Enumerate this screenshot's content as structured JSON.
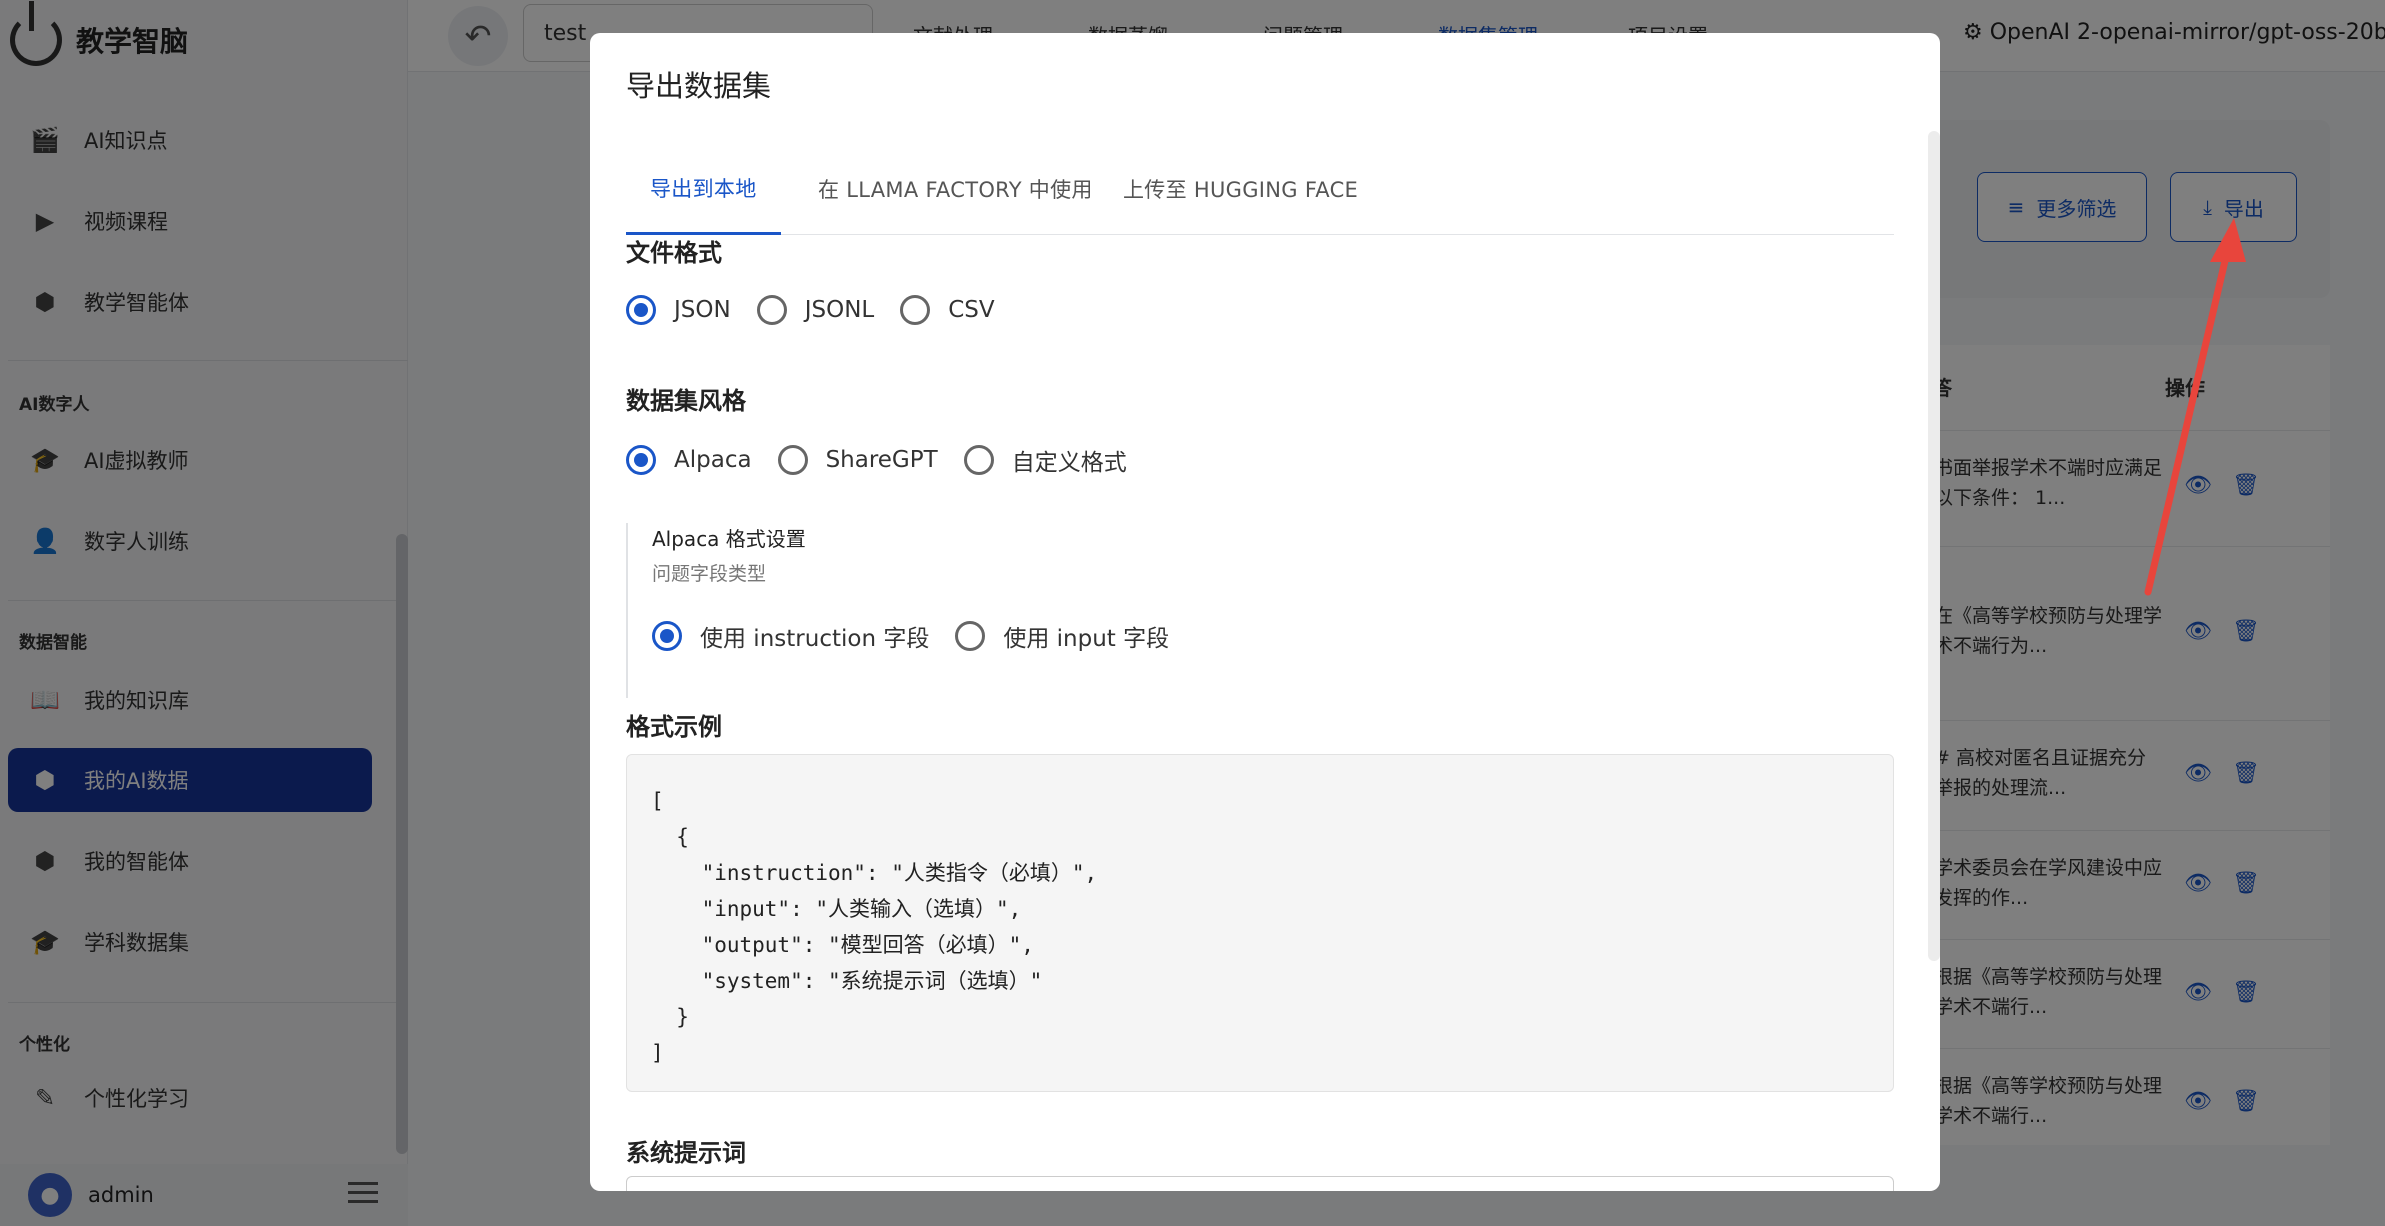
{
  "app": {
    "name": "教学智脑"
  },
  "sidebar": {
    "items": [
      {
        "label": "AI知识点",
        "icon": "clapperboard-icon"
      },
      {
        "label": "视频课程",
        "icon": "play-video-icon"
      },
      {
        "label": "教学智能体",
        "icon": "cube-icon"
      }
    ],
    "sections": [
      {
        "title": "AI数字人",
        "items": [
          {
            "label": "AI虚拟教师",
            "icon": "graduation-cap-icon"
          },
          {
            "label": "数字人训练",
            "icon": "person-icon"
          }
        ]
      },
      {
        "title": "数据智能",
        "items": [
          {
            "label": "我的知识库",
            "icon": "book-icon"
          },
          {
            "label": "我的AI数据",
            "icon": "data-cube-icon",
            "active": true
          },
          {
            "label": "我的智能体",
            "icon": "cube-icon"
          },
          {
            "label": "学科数据集",
            "icon": "graduation-cap-icon"
          }
        ]
      },
      {
        "title": "个性化",
        "items": [
          {
            "label": "个性化学习",
            "icon": "magic-wand-icon"
          }
        ]
      }
    ],
    "user": {
      "name": "admin"
    }
  },
  "topbar": {
    "project": "test",
    "tabs": [
      "文献处理",
      "数据蒸馏",
      "问题管理",
      "数据集管理",
      "项目设置"
    ],
    "active_tab": "数据集管理",
    "model": "OpenAI 2-openai-mirror/gpt-oss-20b"
  },
  "background": {
    "more_filters": "更多筛选",
    "export": "导出",
    "col_answer": "答",
    "col_action": "操作",
    "rows": [
      "书面举报学术不端时应满足以下条件： 1...",
      "在《高等学校预防与处理学术不端行为...",
      "# 高校对匿名且证据充分举报的处理流...",
      "学术委员会在学风建设中应发挥的作...",
      "根据《高等学校预防与处理学术不端行...",
      "根据《高等学校预防与处理学术不端行..."
    ]
  },
  "modal": {
    "title": "导出数据集",
    "tabs": [
      "导出到本地",
      "在 LLAMA FACTORY 中使用",
      "上传至 HUGGING FACE"
    ],
    "active_tab": "导出到本地",
    "file_format": {
      "label": "文件格式",
      "options": [
        "JSON",
        "JSONL",
        "CSV"
      ],
      "selected": "JSON"
    },
    "dataset_style": {
      "label": "数据集风格",
      "options": [
        "Alpaca",
        "ShareGPT",
        "自定义格式"
      ],
      "selected": "Alpaca"
    },
    "alpaca_settings": {
      "title": "Alpaca 格式设置",
      "subtitle": "问题字段类型",
      "options": [
        "使用 instruction 字段",
        "使用 input 字段"
      ],
      "selected": "使用 instruction 字段"
    },
    "format_example": {
      "label": "格式示例",
      "lines": [
        "[",
        "  {",
        "    \"instruction\": \"人类指令（必填）\",",
        "    \"input\": \"人类输入（选填）\",",
        "    \"output\": \"模型回答（必填）\",",
        "    \"system\": \"系统提示词（选填）\"",
        "  }",
        "]"
      ]
    },
    "system_prompt": {
      "label": "系统提示词"
    }
  },
  "colors": {
    "accent": "#1a56c8",
    "sidebar_active": "#17359b",
    "annotation_arrow": "#e8453c"
  }
}
